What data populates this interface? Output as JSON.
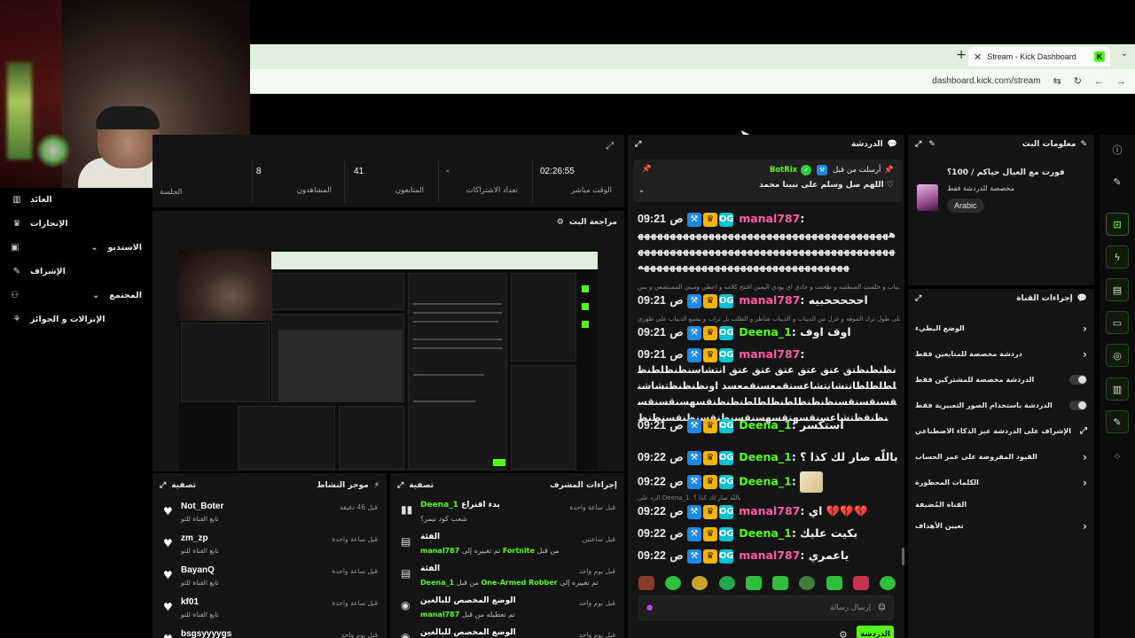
{
  "browser": {
    "tab_title": "Stream - Kick Dashboard",
    "url": "dashboard.kick.com/stream"
  },
  "nav": {
    "items": [
      {
        "label": "العائد"
      },
      {
        "label": "الإنجازات"
      },
      {
        "label": "الاستديو"
      },
      {
        "label": "الإشراف"
      },
      {
        "label": "المجتمع"
      },
      {
        "label": "الإنزالات و الجوائز"
      }
    ]
  },
  "stats": {
    "session_label": "الجلسة",
    "items": [
      {
        "value": "8",
        "label": "المشاهدون"
      },
      {
        "value": "41",
        "label": "المتابعون"
      },
      {
        "value": "-",
        "label": "تعداد الاشتراكات"
      },
      {
        "value": "02:26:55",
        "label": "الوقت مباشر"
      }
    ]
  },
  "preview": {
    "title": "مراجعة البث"
  },
  "activity": {
    "title": "موجز النشاط",
    "filter": "تصفية",
    "rows": [
      {
        "name": "Not_Boter",
        "sub": "تابع القناة للتو",
        "time": "قبل 46 دقيقة"
      },
      {
        "name": "zm_zp",
        "sub": "تابع القناة للتو",
        "time": "قبل ساعة واحدة"
      },
      {
        "name": "BayanQ",
        "sub": "تابع القناة للتو",
        "time": "قبل ساعة واحدة"
      },
      {
        "name": "kf01",
        "sub": "تابع القناة للتو",
        "time": "قبل ساعة واحدة"
      },
      {
        "name": "bsgsyyyygs",
        "sub": "",
        "time": "قبل يوم واحد"
      }
    ]
  },
  "mod": {
    "title": "إجراءات المشرف",
    "filter": "تصفية",
    "rows": [
      {
        "icon": "poll-icon",
        "title_user": "Deena_1",
        "title_rest": "بدء اقتراع",
        "sub": "شعب كود نيمز؟",
        "time": "قبل ساعة واحدة"
      },
      {
        "icon": "category-icon",
        "title": "الفئة",
        "sub_user": "manal787",
        "sub_mid": "تم تغييره إلى",
        "sub_value": "Fortnite",
        "sub_from": "من قبل",
        "time": "قبل ساعتين"
      },
      {
        "icon": "category-icon",
        "title": "الفئة",
        "sub_user": "Deena_1",
        "sub_mid": "تم تغييره إلى",
        "sub_value": "One-Armed Robber",
        "sub_from": "من قبل",
        "time": "قبل يوم واحد"
      },
      {
        "icon": "eye-icon",
        "title": "الوضع المخصص للبالغين",
        "sub_user": "manal787",
        "sub_mid": "تم تعطيله من قبل",
        "time": "قبل يوم واحد"
      },
      {
        "icon": "eye-icon",
        "title": "الوضع المخصص للبالغين",
        "time": "قبل يوم واحد"
      }
    ]
  },
  "chat": {
    "title": "الدردشة",
    "pinned": {
      "by_label": "أرسلت من قبل",
      "user": "BotRix",
      "message": "اللهم صل وسلم على نبينا محمد"
    },
    "messages": [
      {
        "time": "09:21",
        "ampm": "ص",
        "user": "manal787",
        "text": "",
        "body": "ههههههههههههههههههههههههههههههههههههههههههههههههههههههههههههههههههههههههههههههههههههههههههههههههههههههههههههههههه"
      },
      {
        "time": "09:21",
        "ampm": "ص",
        "user": "manal787",
        "text": "احححححبيه"
      },
      {
        "time": "09:21",
        "ampm": "ص",
        "user": "Deena_1",
        "text": "اوف اوف"
      },
      {
        "time": "09:21",
        "ampm": "ص",
        "user": "manal787",
        "text": "",
        "body": "نظنظنظتق عتق عتق عتق عتق عتق انتشاسنظنظلطنظلطلطلطانتشانتشاعسنقمعسنقمعسد اونظنظنظتشاشنقسنقسنقسنظنظنظلطنظلطلطنظنظنقسهسنقسنقسنظنقظتشاعسنقسهنقسهسنقسنظنقسنظنقسنظنظ"
      },
      {
        "time": "09:21",
        "ampm": "ص",
        "user": "Deena_1",
        "text": "استكسر"
      },
      {
        "time": "09:22",
        "ampm": "ص",
        "user": "Deena_1",
        "text": "باللّه صار لك كذا ؟"
      },
      {
        "time": "09:22",
        "ampm": "ص",
        "user": "Deena_1",
        "text": ""
      },
      {
        "time": "09:22",
        "ampm": "ص",
        "user": "manal787",
        "text": "اي 💔💔💔"
      },
      {
        "time": "09:22",
        "ampm": "ص",
        "user": "Deena_1",
        "text": "بكيت عليك"
      },
      {
        "time": "09:22",
        "ampm": "ص",
        "user": "manal787",
        "text": "ياعمري"
      }
    ],
    "replies": [
      "ديباب و جلست الصطفيه و طحنت و جادي اي يودي اليمين افتتح كلامه و اعطي ومبني المستضعي و بس",
      "على طول ترك الموهه و غزل من الديباب و الديباب شاطر و الطلب بل تراب و يشيع الديباب على ظهري",
      "الرد على Deena_1: باللّه صار لك كذا ؟"
    ],
    "input_placeholder": "إرسال رسالة",
    "send_label": "الدردشة"
  },
  "info": {
    "title": "معلومات البث",
    "stream_title": "فورت مع العيال حياكم / 100؟",
    "category": "مخصصة للدردشة فقط",
    "language": "Arabic"
  },
  "actions": {
    "title": "إجراءات القناة",
    "items": [
      {
        "label": "الوضع البطيء",
        "control": "chevron"
      },
      {
        "label": "دردشة مخصصة للمتابعين فقط",
        "control": "chevron"
      },
      {
        "label": "الدردشة مخصصة للمشتركين فقط",
        "control": "toggle"
      },
      {
        "label": "الدردشة باستخدام الصور التعبيرية فقط",
        "control": "toggle"
      },
      {
        "label": "الإشراف على الدردشة عبر الذكاء الاصطناعي",
        "control": "external"
      },
      {
        "label": "القيود المفروضة على عمر الحساب",
        "control": "chevron"
      },
      {
        "label": "الكلمات المحظورة",
        "control": "chevron"
      },
      {
        "label": "القناة المُضيفة",
        "control": "none"
      },
      {
        "label": "تعيين الأهداف",
        "control": "chevron"
      }
    ]
  },
  "colors": {
    "accent": "#53fc18",
    "panel": "#141414",
    "user_pink": "#ff5aa5"
  }
}
